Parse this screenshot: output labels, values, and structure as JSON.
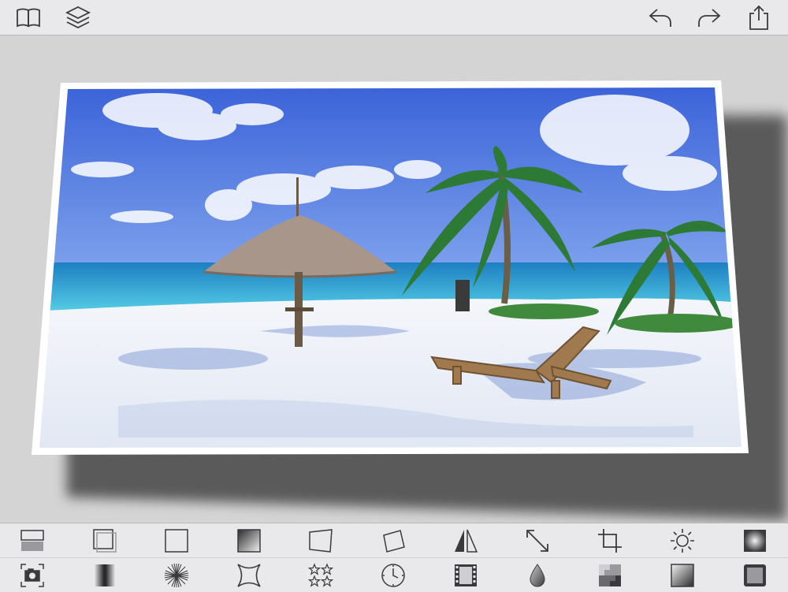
{
  "window": {
    "title": ""
  },
  "topbar": {
    "left": [
      {
        "name": "book-icon",
        "action": "library"
      },
      {
        "name": "layers-icon",
        "action": "layers"
      }
    ],
    "right": [
      {
        "name": "undo-icon",
        "action": "undo"
      },
      {
        "name": "redo-icon",
        "action": "redo"
      },
      {
        "name": "share-icon",
        "action": "share"
      }
    ]
  },
  "colors": {
    "background": "#dcdcdc",
    "bar": "#e9e9eb",
    "icon": "#3a3a3c",
    "frame": "#ffffff",
    "sky_top": "#3f6fe0",
    "sky_bottom": "#8fb0f0",
    "sea": "#39b0d8",
    "sand": "#eef2f8"
  },
  "photo": {
    "subject": "beach",
    "frame": "white-border"
  },
  "toolbar": {
    "row1": [
      "split-horizontal-icon",
      "duplicate-frame-icon",
      "square-frame-icon",
      "gradient-square-icon",
      "perspective-quad-icon",
      "rotate-square-icon",
      "mirror-triangle-icon",
      "resize-arrow-icon",
      "crop-icon",
      "brightness-icon",
      "vignette-square-icon"
    ],
    "row2": [
      "camera-icon",
      "gradient-bars-icon",
      "starburst-icon",
      "concave-square-icon",
      "stars-icon",
      "clock-icon",
      "film-strip-icon",
      "droplet-icon",
      "checker-icon",
      "gradient-frame-icon",
      "inner-frame-icon"
    ]
  }
}
